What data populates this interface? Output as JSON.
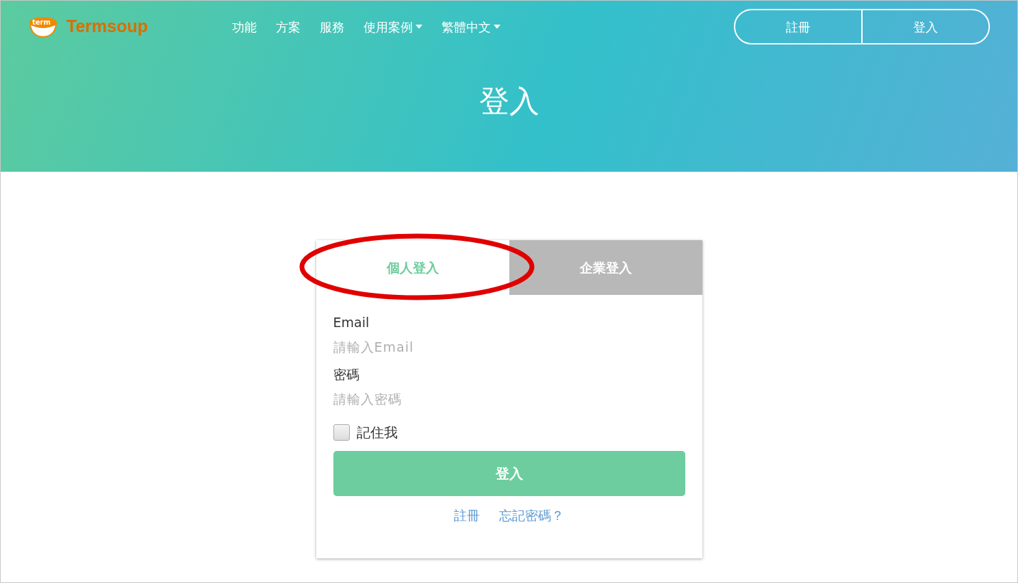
{
  "logo": {
    "badge": "term",
    "name": "Termsoup"
  },
  "nav": [
    {
      "label": "功能",
      "dropdown": false
    },
    {
      "label": "方案",
      "dropdown": false
    },
    {
      "label": "服務",
      "dropdown": false
    },
    {
      "label": "使用案例",
      "dropdown": true
    },
    {
      "label": "繁體中文",
      "dropdown": true
    }
  ],
  "auth_buttons": [
    "註冊",
    "登入"
  ],
  "page_title": "登入",
  "tabs": [
    {
      "label": "個人登入",
      "selected": true
    },
    {
      "label": "企業登入",
      "selected": false
    }
  ],
  "form": {
    "fields": [
      {
        "label": "Email",
        "placeholder": "請輸入Email"
      },
      {
        "label": "密碼",
        "placeholder": "請輸入密碼"
      }
    ],
    "remember": {
      "label": "記住我",
      "checked": false
    },
    "submit": "登入",
    "links": [
      "註冊",
      "忘記密碼？"
    ]
  },
  "annotation": {
    "kind": "ellipse",
    "color": "#e00000"
  }
}
